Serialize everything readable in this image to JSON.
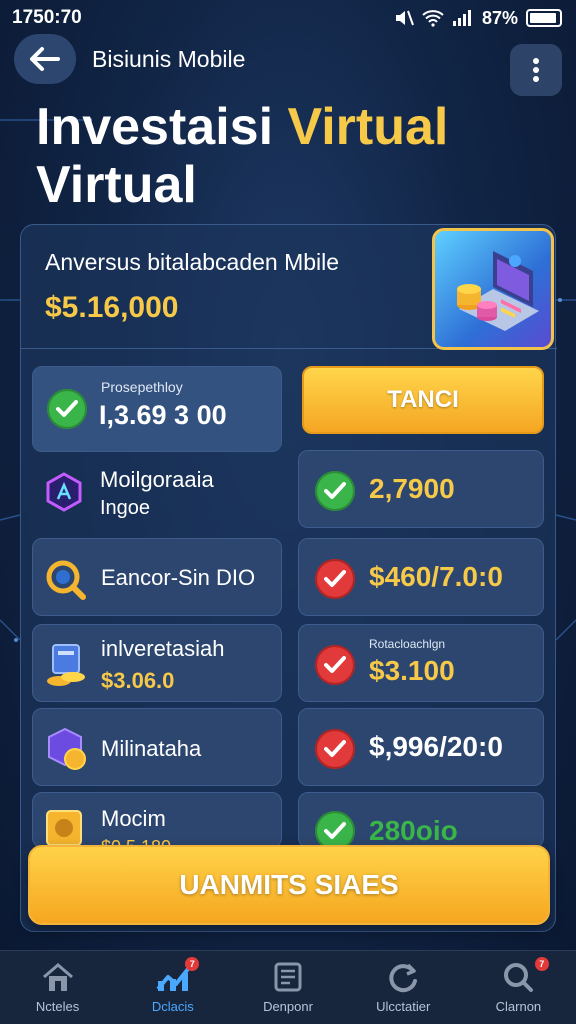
{
  "status": {
    "time": "1750:70",
    "battery": "87%"
  },
  "header": {
    "title": "Bisiunis Mobile",
    "page_title_1": "Investaisi",
    "page_title_hl": "Virtual",
    "page_title_2": "Virtual"
  },
  "summary": {
    "label": "Anversus bitalabcaden Mbile",
    "value": "$5.16,000"
  },
  "left_cards": [
    {
      "small": "Prosepethloy",
      "label": "I,3.69 3 00",
      "icon": "check-icon"
    },
    {
      "label": "Moilgoraaia",
      "label2": "Ingoe",
      "icon": "hexagon-logo-icon"
    },
    {
      "label": "Eancor-Sin DIO",
      "icon": "magnifier-coin-icon"
    },
    {
      "label": "inlveretasiah",
      "value": "$3.06.0",
      "icon": "server-coins-icon"
    },
    {
      "label": "Milinataha",
      "icon": "cube-coin-icon"
    },
    {
      "label": "Mocim",
      "value": "$0.5 180",
      "icon": "safe-coin-icon"
    }
  ],
  "action_button": {
    "label": "TANCI"
  },
  "right_cards": [
    {
      "value": "2,7900",
      "status": "green"
    },
    {
      "value": "$460/7.0:0",
      "status": "red"
    },
    {
      "small": "Rotacloachlgn",
      "value": "$3.100",
      "status": "red"
    },
    {
      "value": "$,996/20:0",
      "status": "red"
    },
    {
      "value": "280oio",
      "status": "green"
    }
  ],
  "cta": {
    "label": "UANMITS SIAES"
  },
  "nav": [
    {
      "label": "Ncteles",
      "icon": "home-icon"
    },
    {
      "label": "Dclacis",
      "icon": "chart-icon",
      "badge": "7"
    },
    {
      "label": "Denponr",
      "icon": "document-icon"
    },
    {
      "label": "Ulcctatier",
      "icon": "refresh-icon"
    },
    {
      "label": "Clarnon",
      "icon": "search-icon",
      "badge": "7"
    }
  ],
  "colors": {
    "accent": "#f7c948",
    "background": "#112546",
    "active_nav": "#4aa8ff"
  }
}
